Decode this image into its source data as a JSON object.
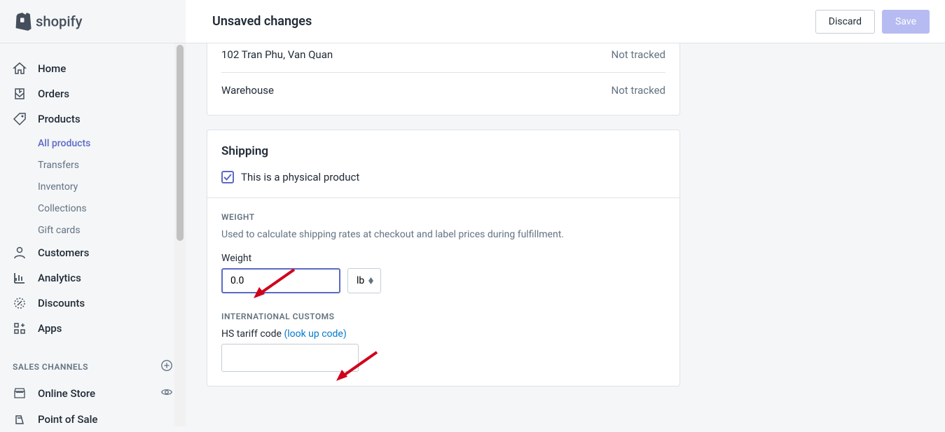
{
  "topbar": {
    "unsaved_title": "Unsaved changes",
    "discard_label": "Discard",
    "save_label": "Save"
  },
  "sidebar": {
    "items": [
      {
        "label": "Home"
      },
      {
        "label": "Orders"
      },
      {
        "label": "Products"
      }
    ],
    "products_sub": [
      {
        "label": "All products",
        "active": true
      },
      {
        "label": "Transfers"
      },
      {
        "label": "Inventory"
      },
      {
        "label": "Collections"
      },
      {
        "label": "Gift cards"
      }
    ],
    "items2": [
      {
        "label": "Customers"
      },
      {
        "label": "Analytics"
      },
      {
        "label": "Discounts"
      },
      {
        "label": "Apps"
      }
    ],
    "sales_channels_heading": "SALES CHANNELS",
    "channels": [
      {
        "label": "Online Store"
      },
      {
        "label": "Point of Sale"
      }
    ]
  },
  "inventory": {
    "rows": [
      {
        "location": "102 Tran Phu, Van Quan",
        "status": "Not tracked"
      },
      {
        "location": "Warehouse",
        "status": "Not tracked"
      }
    ]
  },
  "shipping": {
    "title": "Shipping",
    "physical_label": "This is a physical product",
    "weight_heading": "WEIGHT",
    "weight_desc": "Used to calculate shipping rates at checkout and label prices during fulfillment.",
    "weight_label": "Weight",
    "weight_value": "0.0",
    "weight_unit": "lb",
    "customs_heading": "INTERNATIONAL CUSTOMS",
    "hs_label": "HS tariff code ",
    "hs_link": "(look up code)",
    "hs_value": ""
  }
}
